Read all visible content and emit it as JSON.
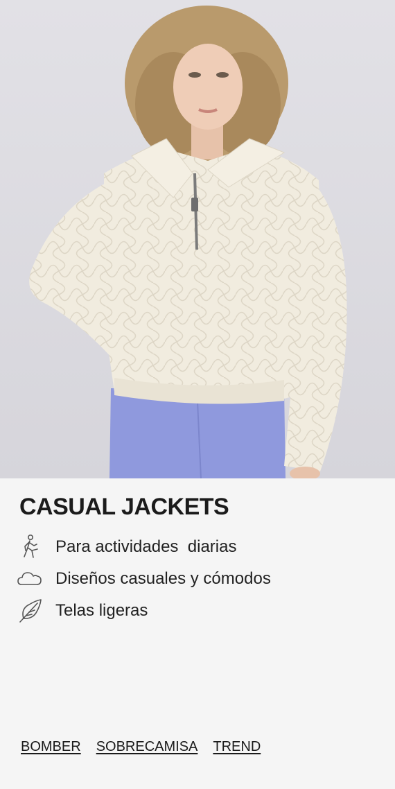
{
  "hero": {
    "image_alt": "model-wearing-quilted-half-zip-jacket"
  },
  "card": {
    "title": "CASUAL JACKETS",
    "features": [
      {
        "icon": "walking-person-icon",
        "label": "Para actividades  diarias"
      },
      {
        "icon": "cloud-icon",
        "label": "Diseños casuales y cómodos"
      },
      {
        "icon": "feather-icon",
        "label": "Telas ligeras"
      }
    ],
    "links": [
      "BOMBER",
      "SOBRECAMISA",
      "TREND"
    ]
  },
  "colors": {
    "background": "#f5f5f5",
    "text": "#1b1b1b",
    "jacket": "#f1ecdf",
    "leggings": "#8f99dd"
  }
}
